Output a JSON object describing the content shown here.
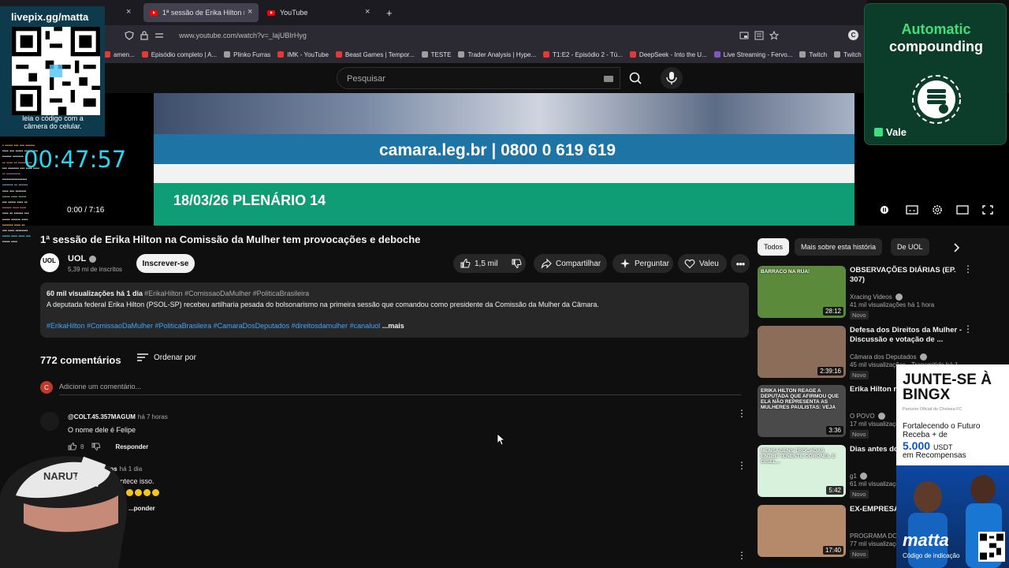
{
  "browser": {
    "tabs": [
      {
        "label": "1ª sessão de Erika Hilton na",
        "active": true
      },
      {
        "label": "YouTube",
        "active": false
      }
    ],
    "new_tab": "+",
    "url": "www.youtube.com/watch?v=_lajUBIrHyg",
    "bookmarks": [
      {
        "label": "amen...",
        "color": "#e53935"
      },
      {
        "label": "Episódio completo | A...",
        "color": "#e53935"
      },
      {
        "label": "Plinko Furras",
        "color": "#9e9e9e"
      },
      {
        "label": "IMK - YouTube",
        "color": "#e53935"
      },
      {
        "label": "Beast Games | Tempor...",
        "color": "#e53935"
      },
      {
        "label": "TESTE",
        "color": "#9e9e9e"
      },
      {
        "label": "Trader Analysis | Hype...",
        "color": "#9e9e9e"
      },
      {
        "label": "T1:E2 - Episódio 2 - Tú...",
        "color": "#e53935"
      },
      {
        "label": "DeepSeek - Into the U...",
        "color": "#e53935"
      },
      {
        "label": "Live Streaming - Fervo...",
        "color": "#7e57c2"
      },
      {
        "label": "Twitch",
        "color": "#9e9e9e"
      },
      {
        "label": "Twitch",
        "color": "#9e9e9e"
      }
    ]
  },
  "search": {
    "placeholder": "Pesquisar"
  },
  "video": {
    "banner_text": "camara.leg.br | 0800 0 619 619",
    "lower_third": "18/03/26  PLENÁRIO 14",
    "time": "0:00 / 7:16"
  },
  "watch": {
    "title": "1ª sessão de Erika Hilton na Comissão da Mulher tem provocações e deboche",
    "channel": {
      "name": "UOL",
      "subs": "5,39 mi de inscritos",
      "avatar_text": "UOL"
    },
    "subscribe": "Inscrever-se",
    "likes": "1,5 mil",
    "share": "Compartilhar",
    "ask": "Perguntar",
    "thanks": "Valeu",
    "description": {
      "meta": "60 mil visualizações  há 1 dia",
      "tags": "#ErikaHilton #ComissaoDaMulher #PoliticaBrasileira",
      "text": "A deputada federal Erika Hilton (PSOL-SP) recebeu artilharia pesada do bolsonarismo na primeira sessão que comandou como presidente da Comissão da Mulher da Câmara.",
      "hashtags": "#ErikaHilton #ComissaoDaMulher #PoliticaBrasileira #CamaraDosDeputados #direitosdamulher #canaluol",
      "more": "...mais"
    }
  },
  "comments": {
    "count": "772 comentários",
    "sort": "Ordenar por",
    "add_avatar": "C",
    "add_placeholder": "Adicione um comentário...",
    "items": [
      {
        "author": "@COLT.45.357MAGUM",
        "time": "há 7 horas",
        "text": "O nome dele é Felipe",
        "likes": "8",
        "reply": "Responder"
      },
      {
        "author": "...tos",
        "time": "há 1 dia",
        "text": "...ntece isso.",
        "likes": "",
        "reply": "...ponder"
      }
    ]
  },
  "sidebar": {
    "chips": [
      "Todos",
      "Mais sobre esta história",
      "De UOL"
    ],
    "recs": [
      {
        "title": "OBSERVAÇÕES DIÁRIAS (EP. 307)",
        "channel": "Xracing Videos",
        "views": "41 mil visualizações  há 1 hora",
        "badge": "Novo",
        "duration": "28:12",
        "thumb_text": "BARRACO NA RUA!",
        "color": "#5a8a3a"
      },
      {
        "title": "Defesa dos Direitos da Mulher - Discussão e votação de ...",
        "channel": "Câmara dos Deputados",
        "views": "45 mil visualizações · Transmitido há 1...",
        "badge": "Novo",
        "duration": "2:39:16",
        "thumb_text": "",
        "color": "#8c6d5a"
      },
      {
        "title": "Erika Hilton re... que afirmou q...",
        "channel": "O POVO",
        "views": "17 mil visualizações",
        "badge": "Novo",
        "duration": "3:36",
        "thumb_text": "ERIKA HILTON REAGE A DEPUTADA QUE AFIRMOU QUE ELA NÃO REPRESENTA AS MULHERES PAULISTAS: VEJA",
        "color": "#4a4a4a"
      },
      {
        "title": "Dias antes do... coronel falou ...",
        "channel": "g1",
        "views": "61 mil visualizações",
        "badge": "Novo",
        "duration": "5:42",
        "thumb_text": "MENSAGENS TROCADAS ENTRE TENENTE CORONEL E GISEL...",
        "color": "#d7f1dd"
      },
      {
        "title": "EX-EMPRESÁ... AZUL MANOE...",
        "channel": "PROGRAMA DO ...",
        "views": "77 mil visualizações",
        "badge": "Novo",
        "duration": "17:40",
        "thumb_text": "",
        "color": "#b48a6a"
      }
    ]
  },
  "overlays": {
    "qr_title": "livepix.gg/matta",
    "qr_caption": "leia o código com a câmera do celular.",
    "timer": "00:47:57",
    "promo_title": "Automatic",
    "promo_title2": "compounding",
    "promo_brand": "Vale",
    "bingx_title": "JUNTE-SE À BINGX",
    "bingx_sub": "Parceiro Oficial do Chelsea FC",
    "bingx_line1": "Fortalecendo o Futuro",
    "bingx_line2": "Receba + de",
    "bingx_amount": "5.000",
    "bingx_currency": "USDT",
    "bingx_line3": "em Recompensas",
    "matta_logo": "matta",
    "matta_caption": "Código de indicação"
  }
}
